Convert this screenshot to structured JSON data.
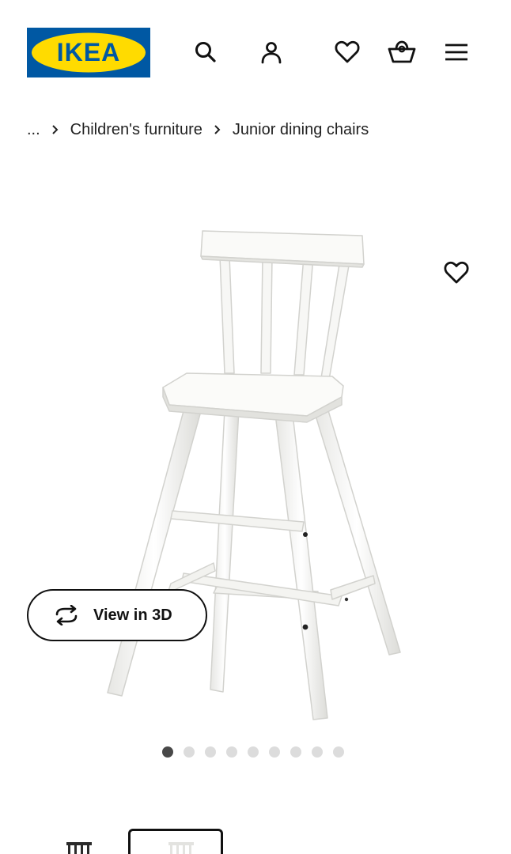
{
  "header": {
    "logo_text": "IKEA",
    "icons": {
      "search": "search-icon",
      "account": "user-icon",
      "favourites": "heart-icon",
      "cart": "shopping-basket-icon",
      "menu": "hamburger-menu-icon"
    },
    "colors": {
      "logo_blue": "#0058A3",
      "logo_yellow": "#FFDB00"
    }
  },
  "breadcrumb": {
    "ellipsis": "...",
    "items": [
      "Children's furniture",
      "Junior dining chairs"
    ]
  },
  "product": {
    "image_icon": "white-junior-chair-image",
    "favourite_icon": "heart-icon"
  },
  "view3d": {
    "label": "View in 3D",
    "icon": "rotate-3d-icon"
  },
  "gallery": {
    "dot_count": 9,
    "active_dot": 1
  }
}
